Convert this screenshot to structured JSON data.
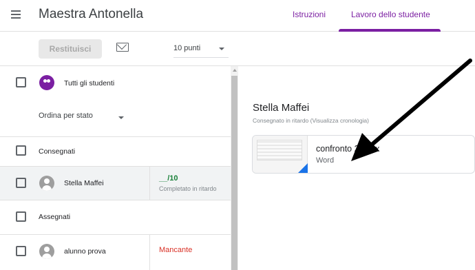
{
  "header": {
    "class_title": "Maestra Antonella",
    "tabs": [
      {
        "label": "Istruzioni"
      },
      {
        "label": "Lavoro dello studente"
      }
    ]
  },
  "toolbar": {
    "return_label": "Restituisci",
    "points_value": "10 punti"
  },
  "list": {
    "all_students_label": "Tutti gli studenti",
    "sort_label": "Ordina per stato",
    "sections": [
      {
        "title": "Consegnati",
        "students": [
          {
            "name": "Stella Maffei",
            "grade": "__/10",
            "status": "Completato in ritardo"
          }
        ]
      },
      {
        "title": "Assegnati",
        "students": [
          {
            "name": "alunno prova",
            "status": "Mancante"
          }
        ]
      }
    ]
  },
  "detail": {
    "student_name": "Stella Maffei",
    "status_text": "Consegnato in ritardo (Visualizza cronologia)",
    "attachment": {
      "file_name": "confronto 2.docx",
      "file_type": "Word"
    }
  },
  "colors": {
    "accent": "#7b1fa2",
    "grade_green": "#188038",
    "missing_red": "#d93025",
    "word_blue": "#1a73e8",
    "arrow": "#000000"
  }
}
